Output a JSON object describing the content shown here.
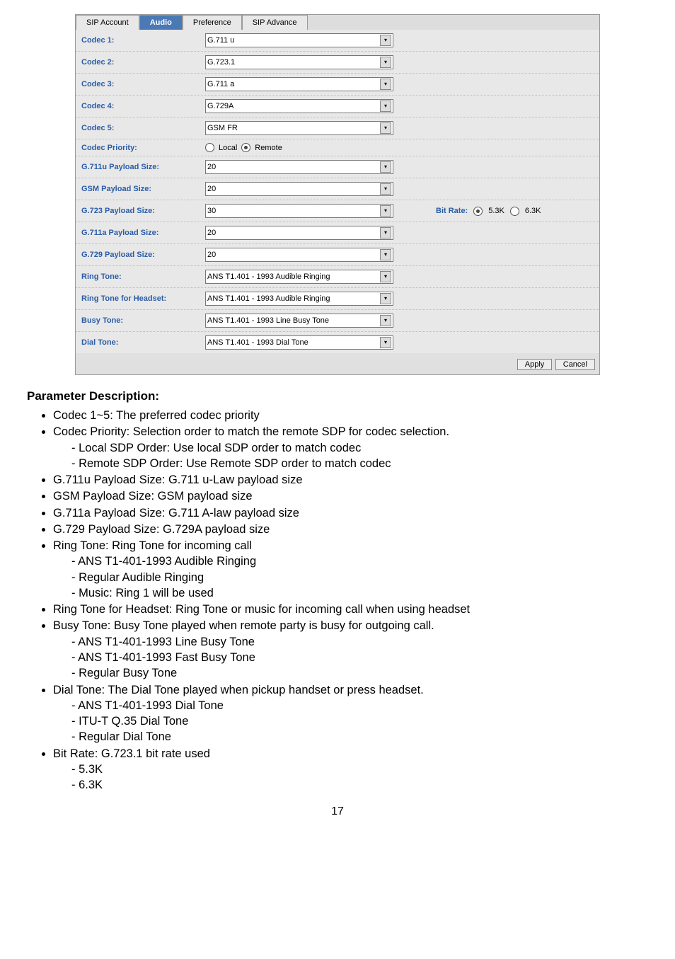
{
  "tabs": {
    "sip_account": "SIP Account",
    "audio": "Audio",
    "preference": "Preference",
    "sip_advance": "SIP Advance"
  },
  "rows": {
    "codec1": {
      "label": "Codec 1:",
      "value": "G.711 u"
    },
    "codec2": {
      "label": "Codec 2:",
      "value": "G.723.1"
    },
    "codec3": {
      "label": "Codec 3:",
      "value": "G.711 a"
    },
    "codec4": {
      "label": "Codec 4:",
      "value": "G.729A"
    },
    "codec5": {
      "label": "Codec 5:",
      "value": "GSM FR"
    },
    "codec_priority": {
      "label": "Codec Priority:",
      "local": "Local",
      "remote": "Remote"
    },
    "g711u": {
      "label": "G.711u Payload Size:",
      "value": "20"
    },
    "gsm": {
      "label": "GSM Payload Size:",
      "value": "20"
    },
    "g723": {
      "label": "G.723 Payload Size:",
      "value": "30"
    },
    "g711a": {
      "label": "G.711a Payload Size:",
      "value": "20"
    },
    "g729": {
      "label": "G.729 Payload Size:",
      "value": "20"
    },
    "ringtone": {
      "label": "Ring Tone:",
      "value": "ANS T1.401 - 1993 Audible Ringing"
    },
    "ringtone_hs": {
      "label": "Ring Tone for Headset:",
      "value": "ANS T1.401 - 1993 Audible Ringing"
    },
    "busytone": {
      "label": "Busy Tone:",
      "value": "ANS T1.401 - 1993 Line Busy Tone"
    },
    "dialtone": {
      "label": "Dial Tone:",
      "value": "ANS T1.401 - 1993 Dial Tone"
    },
    "bitrate": {
      "label": "Bit Rate:",
      "opt1": "5.3K",
      "opt2": "6.3K"
    }
  },
  "buttons": {
    "apply": "Apply",
    "cancel": "Cancel"
  },
  "section_title": "Parameter Description:",
  "doc": {
    "b1": "Codec 1~5: The preferred codec priority",
    "b2": "Codec Priority: Selection order to match the remote SDP for codec selection.",
    "b2s1": "Local SDP Order: Use local SDP order to match codec",
    "b2s2": "Remote SDP Order: Use Remote SDP order to match codec",
    "b3": "G.711u Payload Size: G.711 u-Law payload size",
    "b4": "GSM Payload Size: GSM payload size",
    "b5": "G.711a Payload Size: G.711 A-law payload size",
    "b6": "G.729 Payload Size: G.729A payload size",
    "b7": "Ring Tone: Ring Tone for incoming call",
    "b7s1": "ANS T1-401-1993 Audible Ringing",
    "b7s2": "Regular Audible Ringing",
    "b7s3": "Music: Ring 1 will be used",
    "b8": "Ring Tone for Headset: Ring Tone or music for incoming call when using headset",
    "b9": "Busy Tone: Busy Tone played when remote party is busy for outgoing call.",
    "b9s1": "ANS T1-401-1993 Line Busy Tone",
    "b9s2": "ANS T1-401-1993 Fast Busy Tone",
    "b9s3": "Regular Busy Tone",
    "b10": "Dial Tone: The Dial Tone played when pickup handset or press headset.",
    "b10s1": "ANS T1-401-1993 Dial Tone",
    "b10s2": "ITU-T Q.35 Dial Tone",
    "b10s3": "Regular Dial Tone",
    "b11": "Bit Rate: G.723.1 bit rate used",
    "b11s1": "5.3K",
    "b11s2": "6.3K"
  },
  "page_number": "17"
}
